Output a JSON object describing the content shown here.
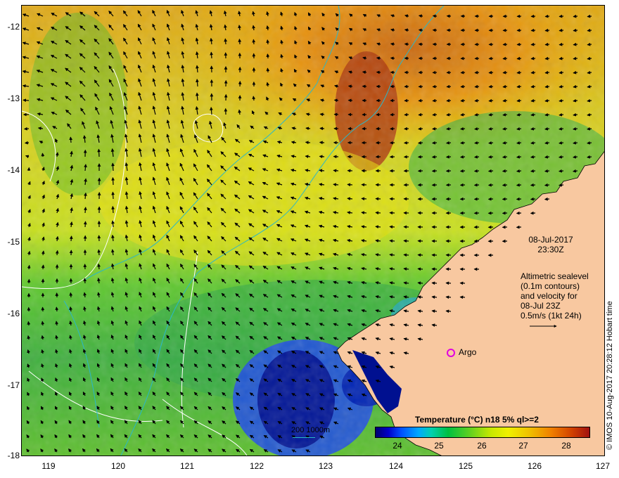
{
  "map": {
    "y_axis_labels": [
      "-12",
      "-13",
      "-14",
      "-15",
      "-16",
      "-17",
      "-18"
    ],
    "x_axis_labels": [
      "119",
      "120",
      "121",
      "122",
      "123",
      "124",
      "125",
      "126",
      "127"
    ],
    "lat_range": [
      -18,
      -12
    ],
    "lon_range": [
      118.6,
      127
    ],
    "date_line": "08-Jul-2017",
    "time_line": "23:30Z",
    "altimetry_lines": [
      "Altimetric sealevel",
      "(0.1m contours)",
      "and velocity for",
      "08-Jul 23Z",
      "0.5m/s (1kt 24h)"
    ],
    "credit": "© IMOS 10-Aug-2017 20:28:12 Hobart time",
    "colorbar_title": "Temperature (°C) n18 5% ql>=2",
    "colorbar_ticks": [
      "24",
      "25",
      "26",
      "27",
      "28"
    ],
    "colorbar_range": [
      23.6,
      28.6
    ],
    "scale_label": "200  1000m",
    "argo_label": "Argo",
    "colors": {
      "land": "#f8c8a0",
      "bathymetry_contour": "#2ab8c8",
      "sealevel_contour": "#ffffff",
      "argo_marker": "#e000e0"
    }
  }
}
